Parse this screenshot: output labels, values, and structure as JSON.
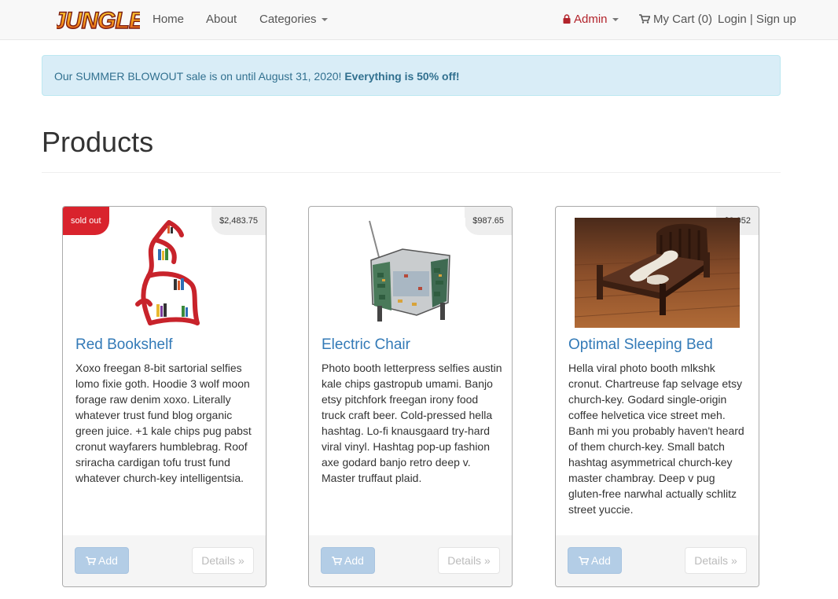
{
  "nav": {
    "brand": "JUNGLE",
    "home": "Home",
    "about": "About",
    "categories": "Categories",
    "admin": "Admin",
    "cart": "My Cart (0)",
    "login": "Login | Sign up"
  },
  "alert": {
    "text": "Our SUMMER BLOWOUT sale is on until August 31, 2020! ",
    "emphasis": "Everything is 50% off!"
  },
  "page_title": "Products",
  "products": [
    {
      "name": "Red Bookshelf",
      "price": "$2,483.75",
      "badge": "sold out",
      "description": "Xoxo freegan 8-bit sartorial selfies lomo fixie goth. Hoodie 3 wolf moon forage raw denim xoxo. Literally whatever trust fund blog organic green juice. +1 kale chips pug pabst cronut wayfarers humblebrag. Roof sriracha cardigan tofu trust fund whatever church-key intelligentsia.",
      "add_label": "Add",
      "details_label": "Details »"
    },
    {
      "name": "Electric Chair",
      "price": "$987.65",
      "description": "Photo booth letterpress selfies austin kale chips gastropub umami. Banjo etsy pitchfork freegan irony food truck craft beer. Cold-pressed hella hashtag. Lo-fi knausgaard try-hard viral vinyl. Hashtag pop-up fashion axe godard banjo retro deep v. Master truffaut plaid.",
      "add_label": "Add",
      "details_label": "Details »"
    },
    {
      "name": "Optimal Sleeping Bed",
      "price": "$3,052",
      "description": "Hella viral photo booth mlkshk cronut. Chartreuse fap selvage etsy church-key. Godard single-origin coffee helvetica vice street meh. Banh mi you probably haven't heard of them church-key. Small batch hashtag asymmetrical church-key master chambray. Deep v pug gluten-free narwhal actually schlitz street yuccie.",
      "add_label": "Add",
      "details_label": "Details »"
    }
  ]
}
